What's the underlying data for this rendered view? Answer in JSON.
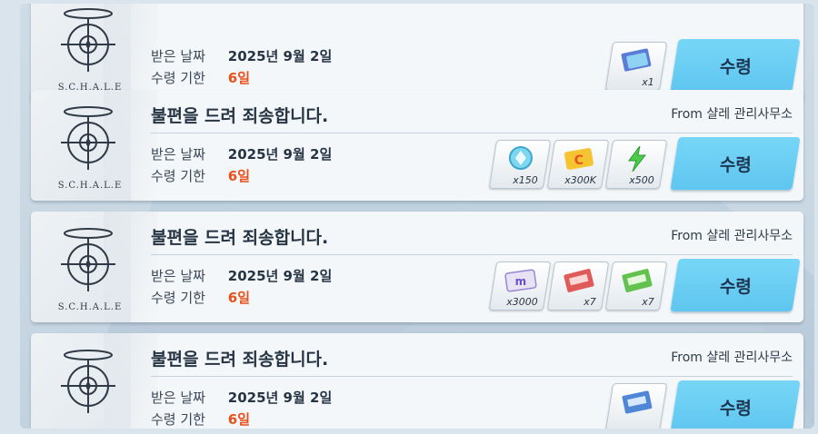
{
  "labels": {
    "received": "받은 날짜",
    "deadline": "수령 기한",
    "claim": "수령"
  },
  "logo_text": "S.C.H.A.L.E",
  "mails": [
    {
      "title": "",
      "from": "",
      "date": "2025년 9월 2일",
      "days_left": "6일",
      "rewards": [
        {
          "icon": "ticket-blue-icon",
          "qty": "x1"
        }
      ]
    },
    {
      "title": "불편을 드려 죄송합니다.",
      "from": "From 샬레 관리사무소",
      "date": "2025년 9월 2일",
      "days_left": "6일",
      "rewards": [
        {
          "icon": "pyroxene-icon",
          "qty": "x150"
        },
        {
          "icon": "credit-card-icon",
          "qty": "x300K"
        },
        {
          "icon": "stamina-bolt-icon",
          "qty": "x500"
        }
      ]
    },
    {
      "title": "불편을 드려 죄송합니다.",
      "from": "From 샬레 관리사무소",
      "date": "2025년 9월 2일",
      "days_left": "6일",
      "rewards": [
        {
          "icon": "eligma-ticket-icon",
          "qty": "x3000"
        },
        {
          "icon": "red-ticket-icon",
          "qty": "x7"
        },
        {
          "icon": "bounty-ticket-icon",
          "qty": "x7"
        }
      ]
    },
    {
      "title": "불편을 드려 죄송합니다.",
      "from": "From 샬레 관리사무소",
      "date": "2025년 9월 2일",
      "days_left": "6일",
      "rewards": [
        {
          "icon": "lesson-ticket-icon",
          "qty": ""
        }
      ]
    }
  ],
  "colors": {
    "accent": "#6fd0f5",
    "warn": "#e8501c",
    "text": "#263444"
  }
}
